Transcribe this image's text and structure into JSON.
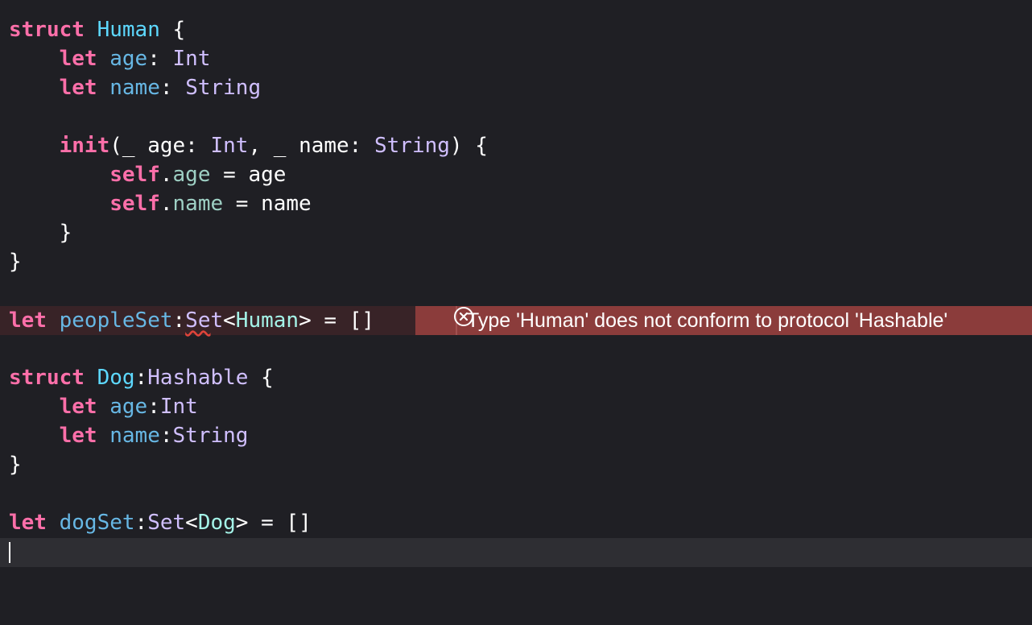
{
  "colors": {
    "background": "#1f1f24",
    "keyword": "#fc6fa9",
    "type_declaration": "#5dd8ff",
    "type_name": "#d0bfff",
    "property": "#67b7e4",
    "member_access": "#9ed0c4",
    "error_banner": "#8b3c3b",
    "error_line": "#382327",
    "current_line": "#2e2e33"
  },
  "code": {
    "line1": {
      "k": "struct",
      "name": "Human",
      "rest": " {"
    },
    "line2": {
      "indent": "    ",
      "k": "let",
      "prop": "age",
      "sep": ": ",
      "type": "Int"
    },
    "line3": {
      "indent": "    ",
      "k": "let",
      "prop": "name",
      "sep": ": ",
      "type": "String"
    },
    "line5": {
      "indent": "    ",
      "k": "init",
      "p1": "(_ age: ",
      "t1": "Int",
      "p2": ", _ name: ",
      "t2": "String",
      "p3": ") {"
    },
    "line6": {
      "indent": "        ",
      "k": "self",
      "dot": ".",
      "member": "age",
      "rest": " = age"
    },
    "line7": {
      "indent": "        ",
      "k": "self",
      "dot": ".",
      "member": "name",
      "rest": " = name"
    },
    "line8": {
      "text": "    }"
    },
    "line9": {
      "text": "}"
    },
    "line11": {
      "k": "let",
      "prop": "peopleSet",
      "colon": ":",
      "err_word": "Se",
      "type_rest": "t",
      "lt": "<",
      "typeref": "Human",
      "rest": "> = []"
    },
    "line13": {
      "k": "struct",
      "name": "Dog",
      "colon": ":",
      "type": "Hashable",
      "rest": " {"
    },
    "line14": {
      "indent": "    ",
      "k": "let",
      "prop": "age",
      "sep": ":",
      "type": "Int"
    },
    "line15": {
      "indent": "    ",
      "k": "let",
      "prop": "name",
      "sep": ":",
      "type": "String"
    },
    "line16": {
      "text": "}"
    },
    "line18": {
      "k": "let",
      "prop": "dogSet",
      "colon": ":",
      "type": "Set",
      "lt": "<",
      "typeref": "Dog",
      "rest": "> = []"
    }
  },
  "diagnostic": {
    "icon": "error-circle-x-icon",
    "message": "Type 'Human' does not conform to protocol 'Hashable'"
  }
}
